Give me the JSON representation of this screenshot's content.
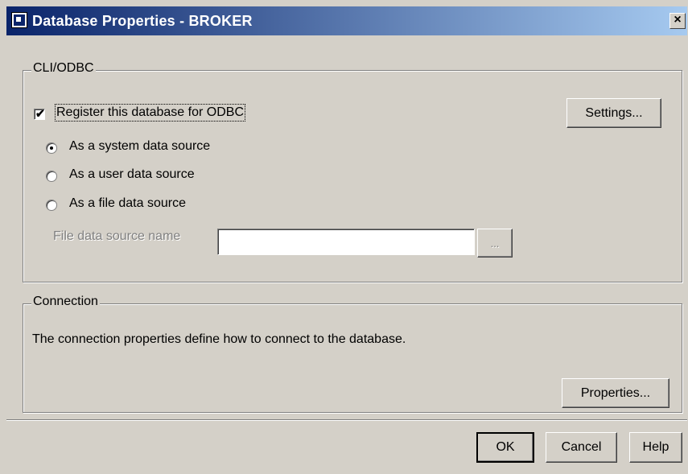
{
  "window": {
    "title": "Database Properties - BROKER",
    "close_glyph": "×"
  },
  "cli_odbc": {
    "legend": "CLI/ODBC",
    "register_checkbox": {
      "label": "Register this database for ODBC",
      "checked": true
    },
    "settings_button": "Settings...",
    "radios": [
      {
        "label": "As a system data source",
        "selected": true
      },
      {
        "label": "As a user data source",
        "selected": false
      },
      {
        "label": "As a file data source",
        "selected": false
      }
    ],
    "file_source_label": "File data source name",
    "file_source_value": "",
    "browse_button": "..."
  },
  "connection": {
    "legend": "Connection",
    "description": "The connection properties define how to connect to the database.",
    "properties_button": "Properties..."
  },
  "footer": {
    "ok_button": "OK",
    "cancel_button": "Cancel",
    "help_button": "Help"
  }
}
